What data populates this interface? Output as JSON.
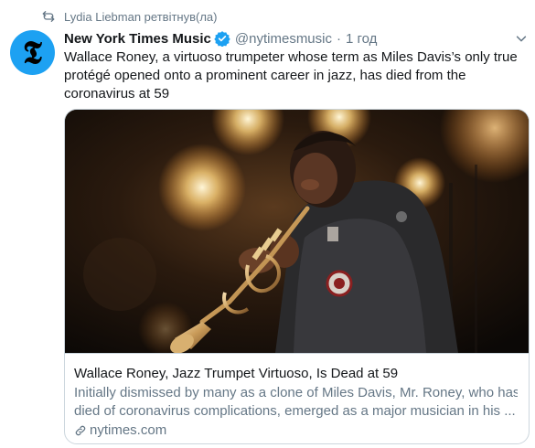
{
  "retweet": {
    "icon": "retweet-icon",
    "text": "Lydia Liebman ретвітнув(ла)"
  },
  "author": {
    "avatar_icon": "nyt-logo-icon",
    "avatar_glyph": "𝕿",
    "name": "New York Times Music",
    "verified_icon": "verified-badge-icon",
    "handle": "@nytimesmusic",
    "separator": "·",
    "time": "1 год"
  },
  "menu_icon": "chevron-down-icon",
  "tweet": {
    "text": "Wallace Roney, a virtuoso trumpeter whose term as Miles Davis’s only true protégé opened onto a prominent career in jazz, has died from the coronavirus at 59"
  },
  "card": {
    "image_subject": "photo-trumpet-player",
    "title": "Wallace Roney, Jazz Trumpet Virtuoso, Is Dead at 59",
    "description_line1": "Initially dismissed by many as a clone of Miles Davis, Mr. Roney, who has",
    "description_line2": "died of coronavirus complications, emerged as a major musician in his ...",
    "link_icon": "link-icon",
    "domain": "nytimes.com"
  },
  "colors": {
    "text_primary": "#14171a",
    "text_secondary": "#657786",
    "border": "#ccd6dd",
    "verified": "#1da1f2",
    "avatar_bg": "#1da1f2"
  }
}
